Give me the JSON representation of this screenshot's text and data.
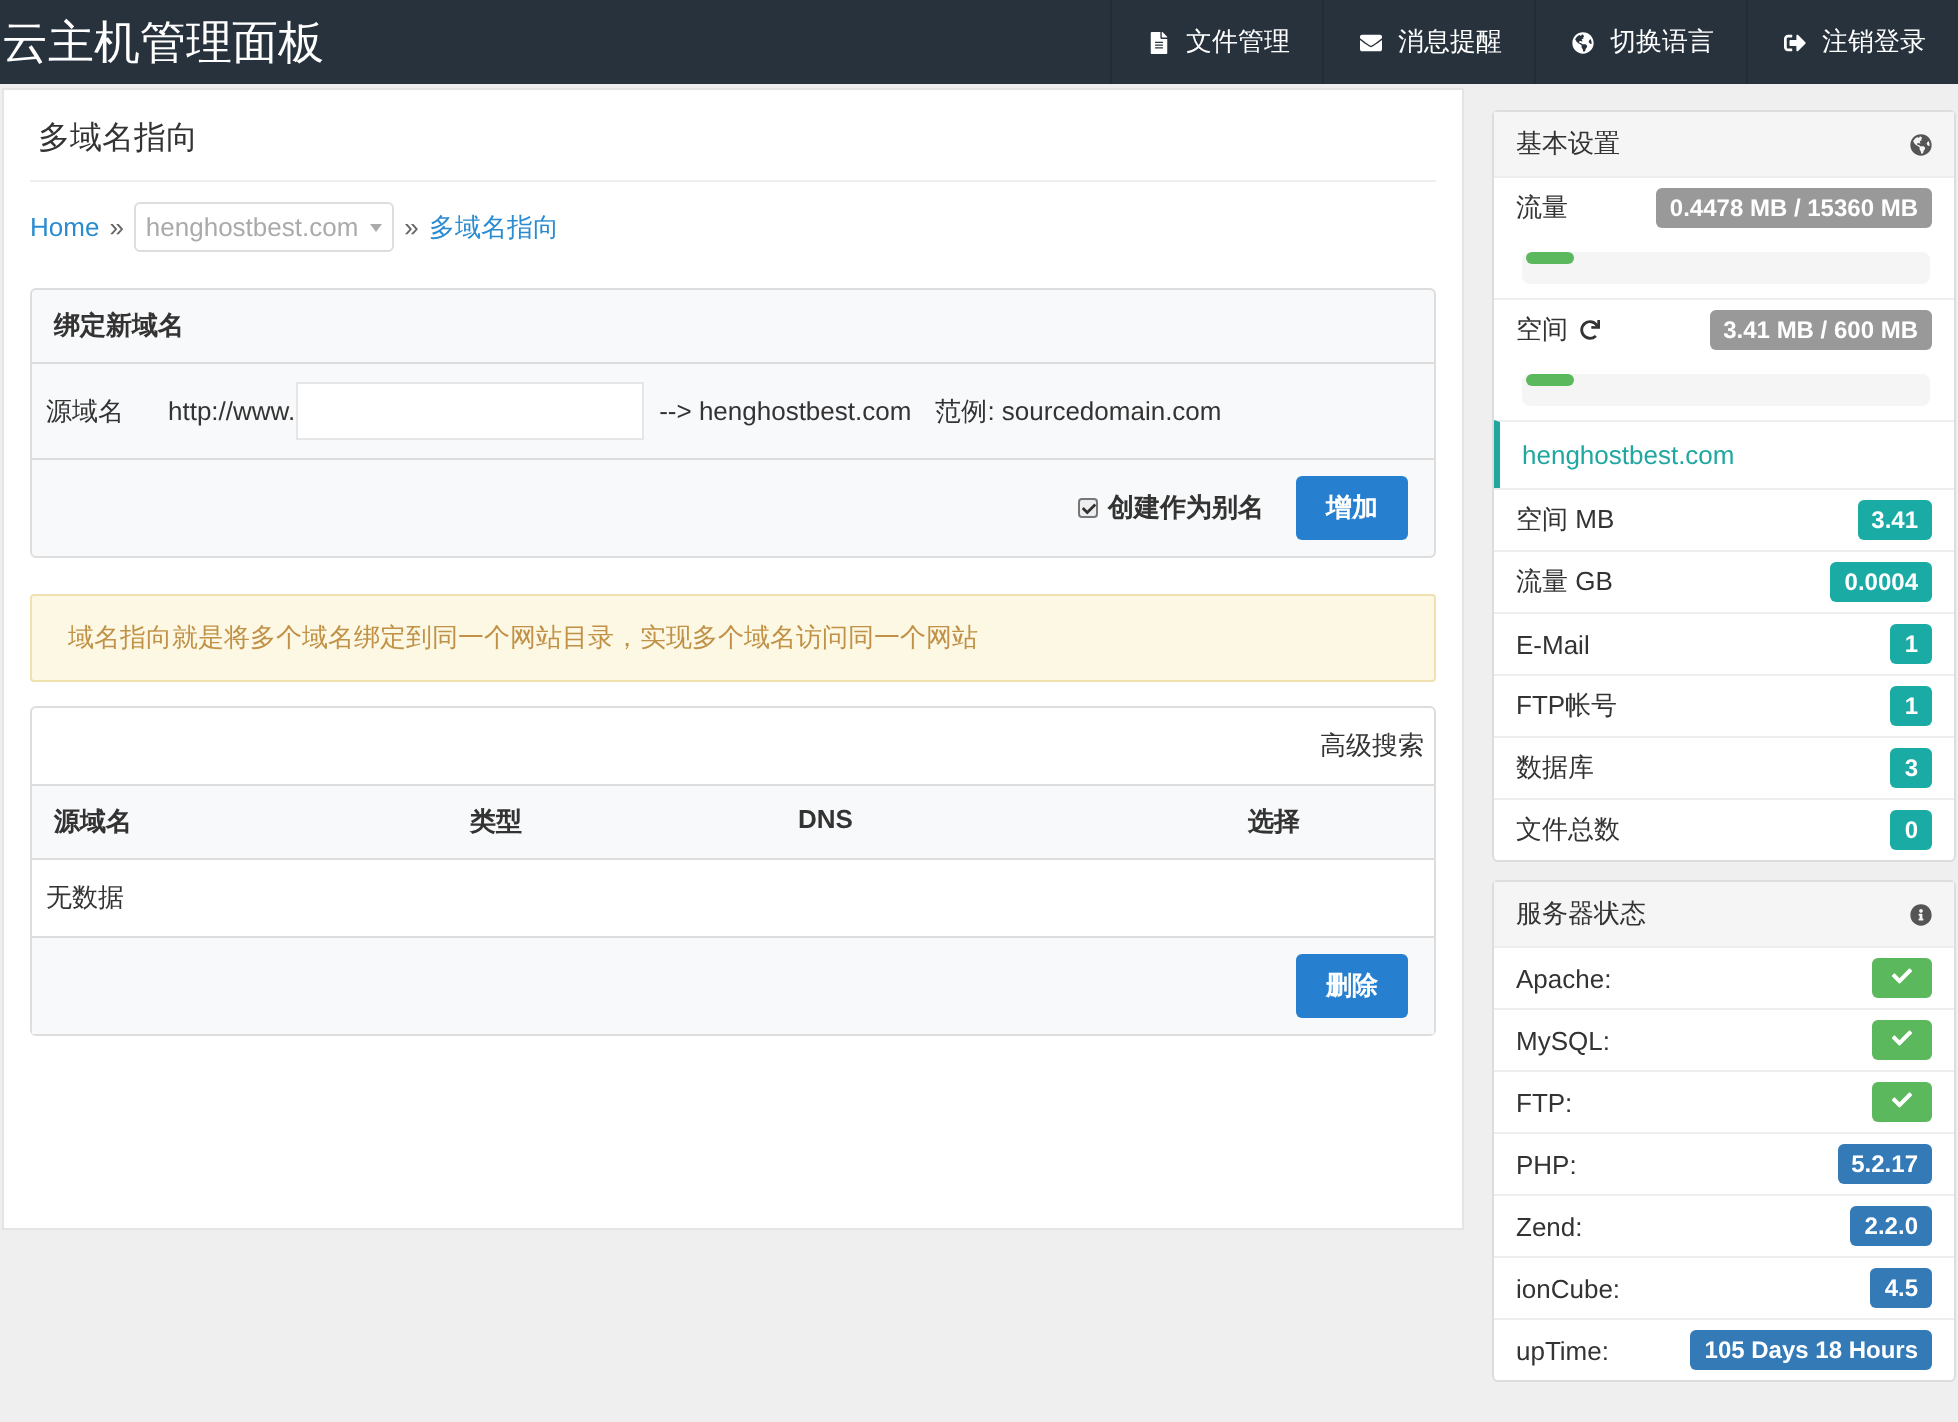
{
  "header": {
    "title": "云主机管理面板",
    "nav": [
      {
        "kind": "file",
        "label": "文件管理"
      },
      {
        "kind": "mail",
        "label": "消息提醒"
      },
      {
        "kind": "globe",
        "label": "切换语言"
      },
      {
        "kind": "logout",
        "label": "注销登录"
      }
    ]
  },
  "page": {
    "title": "多域名指向",
    "breadcrumb": {
      "home": "Home",
      "separator": "»",
      "domain": "henghostbest.com",
      "current": "多域名指向"
    }
  },
  "bind_panel": {
    "title": "绑定新域名",
    "label": "源域名",
    "prefix": "http://www.",
    "target": "--> henghostbest.com",
    "example": "范例: sourcedomain.com",
    "alias": {
      "label": "创建作为别名",
      "checked": true
    },
    "button": "增加"
  },
  "notice": "域名指向就是将多个域名绑定到同一个网站目录，实现多个域名访问同一个网站",
  "table": {
    "search_link": "高级搜索",
    "columns": [
      "源域名",
      "类型",
      "DNS",
      "选择"
    ],
    "empty": "无数据",
    "button": "删除"
  },
  "basic": {
    "title": "基本设置",
    "usage": [
      {
        "label": "流量",
        "refresh": false,
        "reading": "0.4478 MB / 15360 MB",
        "level": 0.12
      },
      {
        "label": "空间",
        "refresh": true,
        "reading": "3.41 MB / 600 MB",
        "level": 0.12
      }
    ],
    "domain": "henghostbest.com",
    "stats": [
      {
        "label": "空间 MB",
        "value": "3.41"
      },
      {
        "label": "流量 GB",
        "value": "0.0004"
      },
      {
        "label": "E-Mail",
        "value": "1"
      },
      {
        "label": "FTP帐号",
        "value": "1"
      },
      {
        "label": "数据库",
        "value": "3"
      },
      {
        "label": "文件总数",
        "value": "0"
      }
    ]
  },
  "server": {
    "title": "服务器状态",
    "items": [
      {
        "label": "Apache:",
        "kind": "ok"
      },
      {
        "label": "MySQL:",
        "kind": "ok"
      },
      {
        "label": "FTP:",
        "kind": "ok"
      },
      {
        "label": "PHP:",
        "kind": "value",
        "value": "5.2.17"
      },
      {
        "label": "Zend:",
        "kind": "value",
        "value": "2.2.0"
      },
      {
        "label": "ionCube:",
        "kind": "value",
        "value": "4.5"
      },
      {
        "label": "upTime:",
        "kind": "value",
        "value": "105 Days 18 Hours"
      }
    ]
  }
}
